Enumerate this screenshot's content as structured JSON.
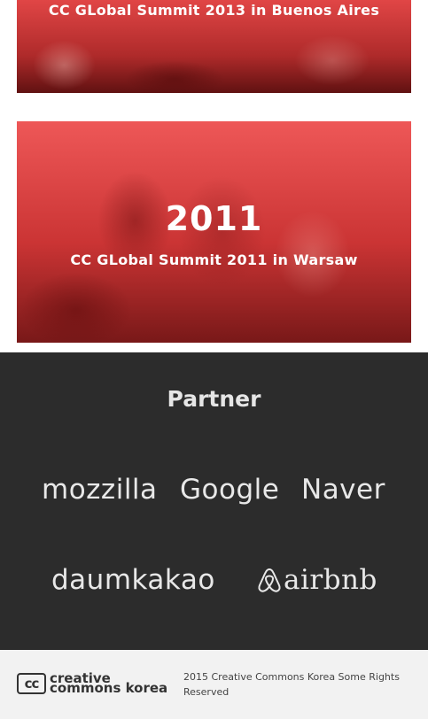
{
  "events": [
    {
      "year": "",
      "title": "CC GLobal Summit 2013 in Buenos Aires"
    },
    {
      "year": "2011",
      "title": "CC GLobal Summit 2011 in Warsaw"
    }
  ],
  "partner": {
    "heading": "Partner",
    "logos": [
      "mozzilla",
      "Google",
      "Naver",
      "daumkakao",
      "airbnb"
    ]
  },
  "footer": {
    "logo_line1": "creative",
    "logo_line2": "commons korea",
    "badge": "cc",
    "copyright": "2015 Creative Commons Korea Some Rights Reserved"
  },
  "colors": {
    "overlay_red": "#d94040",
    "partner_bg": "#2c2c2c",
    "footer_bg": "#f2f2f2"
  }
}
